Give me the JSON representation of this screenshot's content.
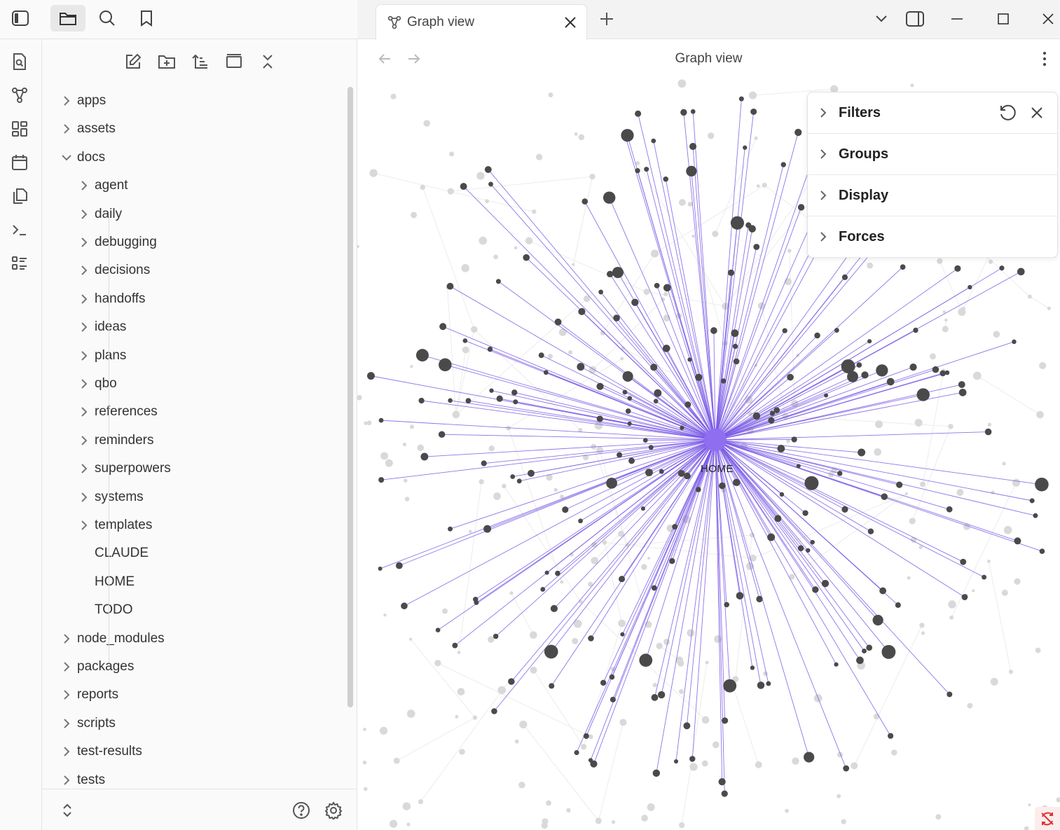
{
  "tab": {
    "title": "Graph view"
  },
  "view": {
    "title": "Graph view"
  },
  "graph": {
    "center_label": "HOME",
    "colors": {
      "link": "#7b5ce6",
      "center": "#8f6ef0",
      "node": "#4a4a4a",
      "faint": "#d9d9d9"
    }
  },
  "controls": {
    "sections": [
      "Filters",
      "Groups",
      "Display",
      "Forces"
    ]
  },
  "explorer": {
    "items": [
      {
        "label": "apps",
        "depth": 0,
        "folder": true,
        "open": false
      },
      {
        "label": "assets",
        "depth": 0,
        "folder": true,
        "open": false
      },
      {
        "label": "docs",
        "depth": 0,
        "folder": true,
        "open": true
      },
      {
        "label": "agent",
        "depth": 1,
        "folder": true,
        "open": false
      },
      {
        "label": "daily",
        "depth": 1,
        "folder": true,
        "open": false
      },
      {
        "label": "debugging",
        "depth": 1,
        "folder": true,
        "open": false
      },
      {
        "label": "decisions",
        "depth": 1,
        "folder": true,
        "open": false
      },
      {
        "label": "handoffs",
        "depth": 1,
        "folder": true,
        "open": false
      },
      {
        "label": "ideas",
        "depth": 1,
        "folder": true,
        "open": false
      },
      {
        "label": "plans",
        "depth": 1,
        "folder": true,
        "open": false
      },
      {
        "label": "qbo",
        "depth": 1,
        "folder": true,
        "open": false
      },
      {
        "label": "references",
        "depth": 1,
        "folder": true,
        "open": false
      },
      {
        "label": "reminders",
        "depth": 1,
        "folder": true,
        "open": false
      },
      {
        "label": "superpowers",
        "depth": 1,
        "folder": true,
        "open": false
      },
      {
        "label": "systems",
        "depth": 1,
        "folder": true,
        "open": false
      },
      {
        "label": "templates",
        "depth": 1,
        "folder": true,
        "open": false
      },
      {
        "label": "CLAUDE",
        "depth": 1,
        "folder": false,
        "open": false
      },
      {
        "label": "HOME",
        "depth": 1,
        "folder": false,
        "open": false
      },
      {
        "label": "TODO",
        "depth": 1,
        "folder": false,
        "open": false
      },
      {
        "label": "node_modules",
        "depth": 0,
        "folder": true,
        "open": false
      },
      {
        "label": "packages",
        "depth": 0,
        "folder": true,
        "open": false
      },
      {
        "label": "reports",
        "depth": 0,
        "folder": true,
        "open": false
      },
      {
        "label": "scripts",
        "depth": 0,
        "folder": true,
        "open": false
      },
      {
        "label": "test-results",
        "depth": 0,
        "folder": true,
        "open": false
      },
      {
        "label": "tests",
        "depth": 0,
        "folder": true,
        "open": false
      }
    ]
  }
}
